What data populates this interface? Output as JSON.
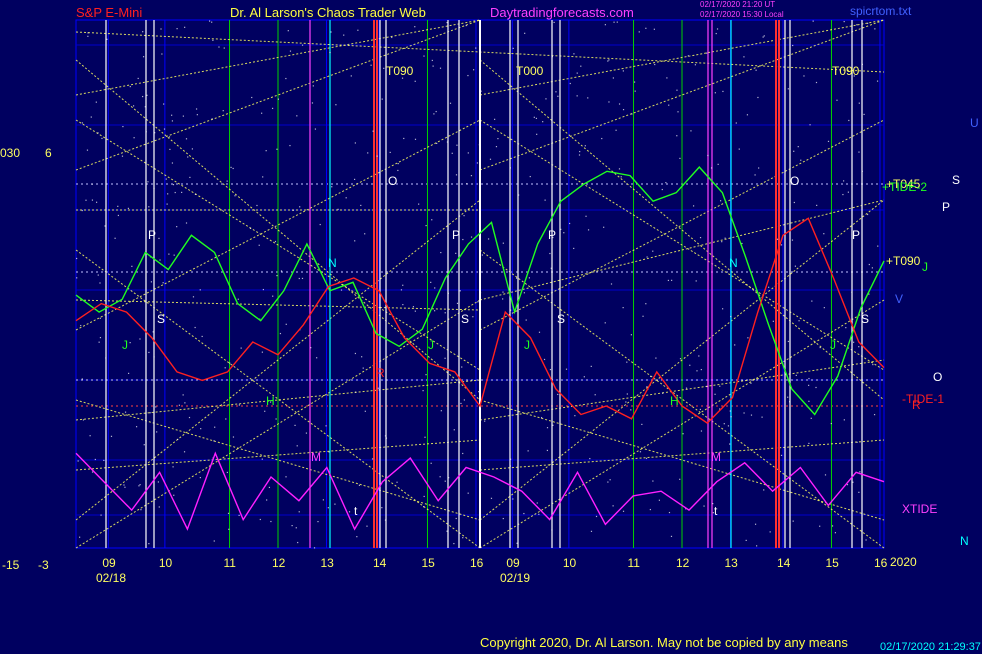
{
  "header": {
    "market": "S&P E-Mini",
    "site_title": "Dr. Al Larson's Chaos Trader Web",
    "site_url": "Daytradingforecasts.com",
    "stamp_line1": "02/17/2020 21:20 UT",
    "stamp_line2": "02/17/2020 15:30 Local",
    "data_file": "spicrtom.txt"
  },
  "left_scale": {
    "top_a": "030",
    "top_b": "6",
    "bottom_a": "-15",
    "bottom_b": "-3"
  },
  "right_labels": {
    "u": "U",
    "s": "S",
    "p": "P",
    "j": "J",
    "v": "V",
    "o": "O",
    "r": "R",
    "n": "N",
    "t045": "+T045",
    "tide2": "+TIDE-2",
    "t090": "+T090",
    "tide1": "-TIDE-1",
    "xtide": "XTIDE",
    "year": "2020"
  },
  "days": [
    {
      "date": "02/18",
      "hours": [
        "09",
        "10",
        "11",
        "12",
        "13",
        "14",
        "15",
        "16"
      ]
    },
    {
      "date": "02/19",
      "hours": [
        "09",
        "10",
        "11",
        "12",
        "13",
        "14",
        "15",
        "16"
      ]
    }
  ],
  "top_markers": {
    "t090_a": "T090",
    "t000": "T000",
    "t090_b": "T090"
  },
  "planet_marks": {
    "p": "P",
    "s": "S",
    "j": "J",
    "n": "N",
    "h": "H",
    "m": "M",
    "o": "O",
    "t": "t",
    "r": "R"
  },
  "footer": {
    "copyright": "Copyright 2020, Dr. Al Larson. May not be copied by any means",
    "stamp": "02/17/2020 21:29:37"
  },
  "colors": {
    "background": "#000060",
    "grid": "#0000ff",
    "tide": "#ff2020",
    "tide2": "#20ff20",
    "xtide": "#ff20ff",
    "lines": "#ffff60",
    "marker": "#ff3030"
  },
  "chart_data": {
    "type": "line",
    "ylim": [
      -3,
      6
    ],
    "x_ticks": [
      "09",
      "10",
      "11",
      "12",
      "13",
      "14",
      "15",
      "16"
    ],
    "series": [
      {
        "name": "+TIDE-2",
        "values": [
          2.6,
          2.2,
          2.5,
          3.6,
          3.2,
          4.0,
          3.6,
          2.4,
          2.0,
          2.7,
          3.8,
          2.7,
          2.9,
          1.7,
          1.4,
          1.8,
          3.0,
          3.8,
          4.3,
          2.2,
          3.8,
          4.8,
          5.2,
          5.5,
          5.4,
          4.8,
          5.0,
          5.6,
          5.0,
          3.5,
          1.9,
          0.4,
          -0.2,
          0.7,
          2.3,
          3.4
        ]
      },
      {
        "name": "-TIDE-1",
        "values": [
          2.0,
          2.4,
          2.2,
          1.6,
          0.8,
          0.6,
          0.8,
          1.5,
          1.2,
          1.9,
          2.8,
          3.0,
          2.7,
          1.6,
          1.0,
          0.8,
          0.0,
          2.2,
          1.6,
          0.4,
          -0.2,
          0.0,
          -0.3,
          0.8,
          0.0,
          -0.4,
          0.2,
          2.2,
          4.0,
          4.4,
          3.0,
          1.5,
          0.9
        ]
      },
      {
        "name": "XTIDE",
        "values": [
          -1.0,
          -1.6,
          -2.2,
          -1.4,
          -2.6,
          -1.0,
          -2.4,
          -1.5,
          -2.0,
          -1.3,
          -2.6,
          -1.6,
          -1.1,
          -2.0,
          -1.3,
          -1.5,
          -1.8,
          -2.4,
          -1.4,
          -2.5,
          -1.9,
          -1.8,
          -2.2,
          -1.6,
          -1.2,
          -1.8,
          -1.3,
          -2.1,
          -1.4,
          -1.6
        ]
      }
    ]
  }
}
